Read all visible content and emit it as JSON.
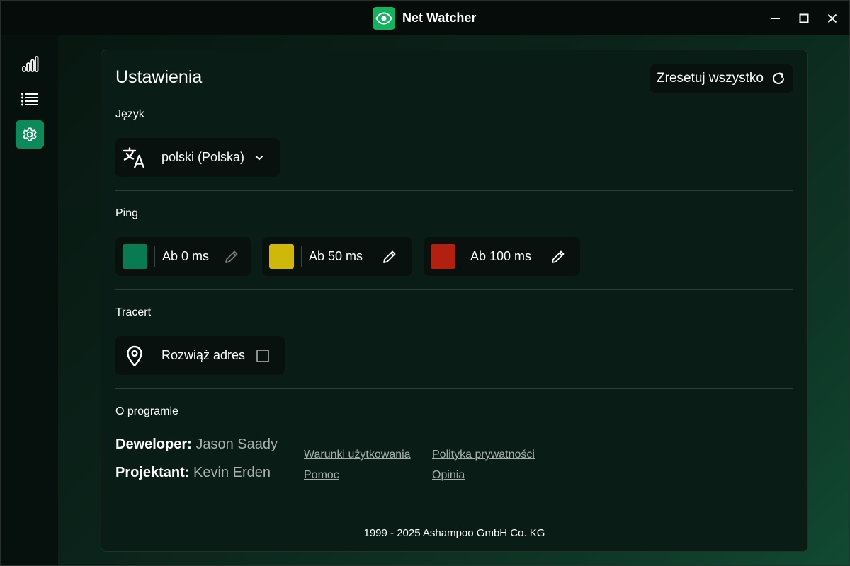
{
  "window": {
    "title": "Net Watcher"
  },
  "sidebar": {
    "items": [
      {
        "name": "statistics",
        "icon": "bar-chart-icon"
      },
      {
        "name": "list",
        "icon": "list-icon"
      },
      {
        "name": "settings",
        "icon": "gear-icon",
        "active": true
      }
    ]
  },
  "settings": {
    "title": "Ustawienia",
    "reset_label": "Zresetuj wszystko",
    "language": {
      "label": "Język",
      "selected": "polski (Polska)"
    },
    "ping": {
      "label": "Ping",
      "thresholds": [
        {
          "label": "Ab 0 ms",
          "color": "#0a7a52"
        },
        {
          "label": "Ab 50 ms",
          "color": "#cfb80a"
        },
        {
          "label": "Ab 100 ms",
          "color": "#b3200f"
        }
      ]
    },
    "tracert": {
      "label": "Tracert",
      "resolve_label": "Rozwiąż adres",
      "resolve_checked": false
    },
    "about": {
      "label": "O programie",
      "developer_key": "Deweloper:",
      "developer_value": "Jason Saady",
      "designer_key": "Projektant:",
      "designer_value": "Kevin Erden",
      "links": {
        "terms": "Warunki użytkowania",
        "privacy": "Polityka prywatności",
        "help": "Pomoc",
        "feedback": "Opinia"
      }
    },
    "footer": "1999 - 2025 Ashampoo GmbH Co. KG"
  },
  "colors": {
    "accent": "#12b25f",
    "active_nav": "#0d8a5a"
  }
}
